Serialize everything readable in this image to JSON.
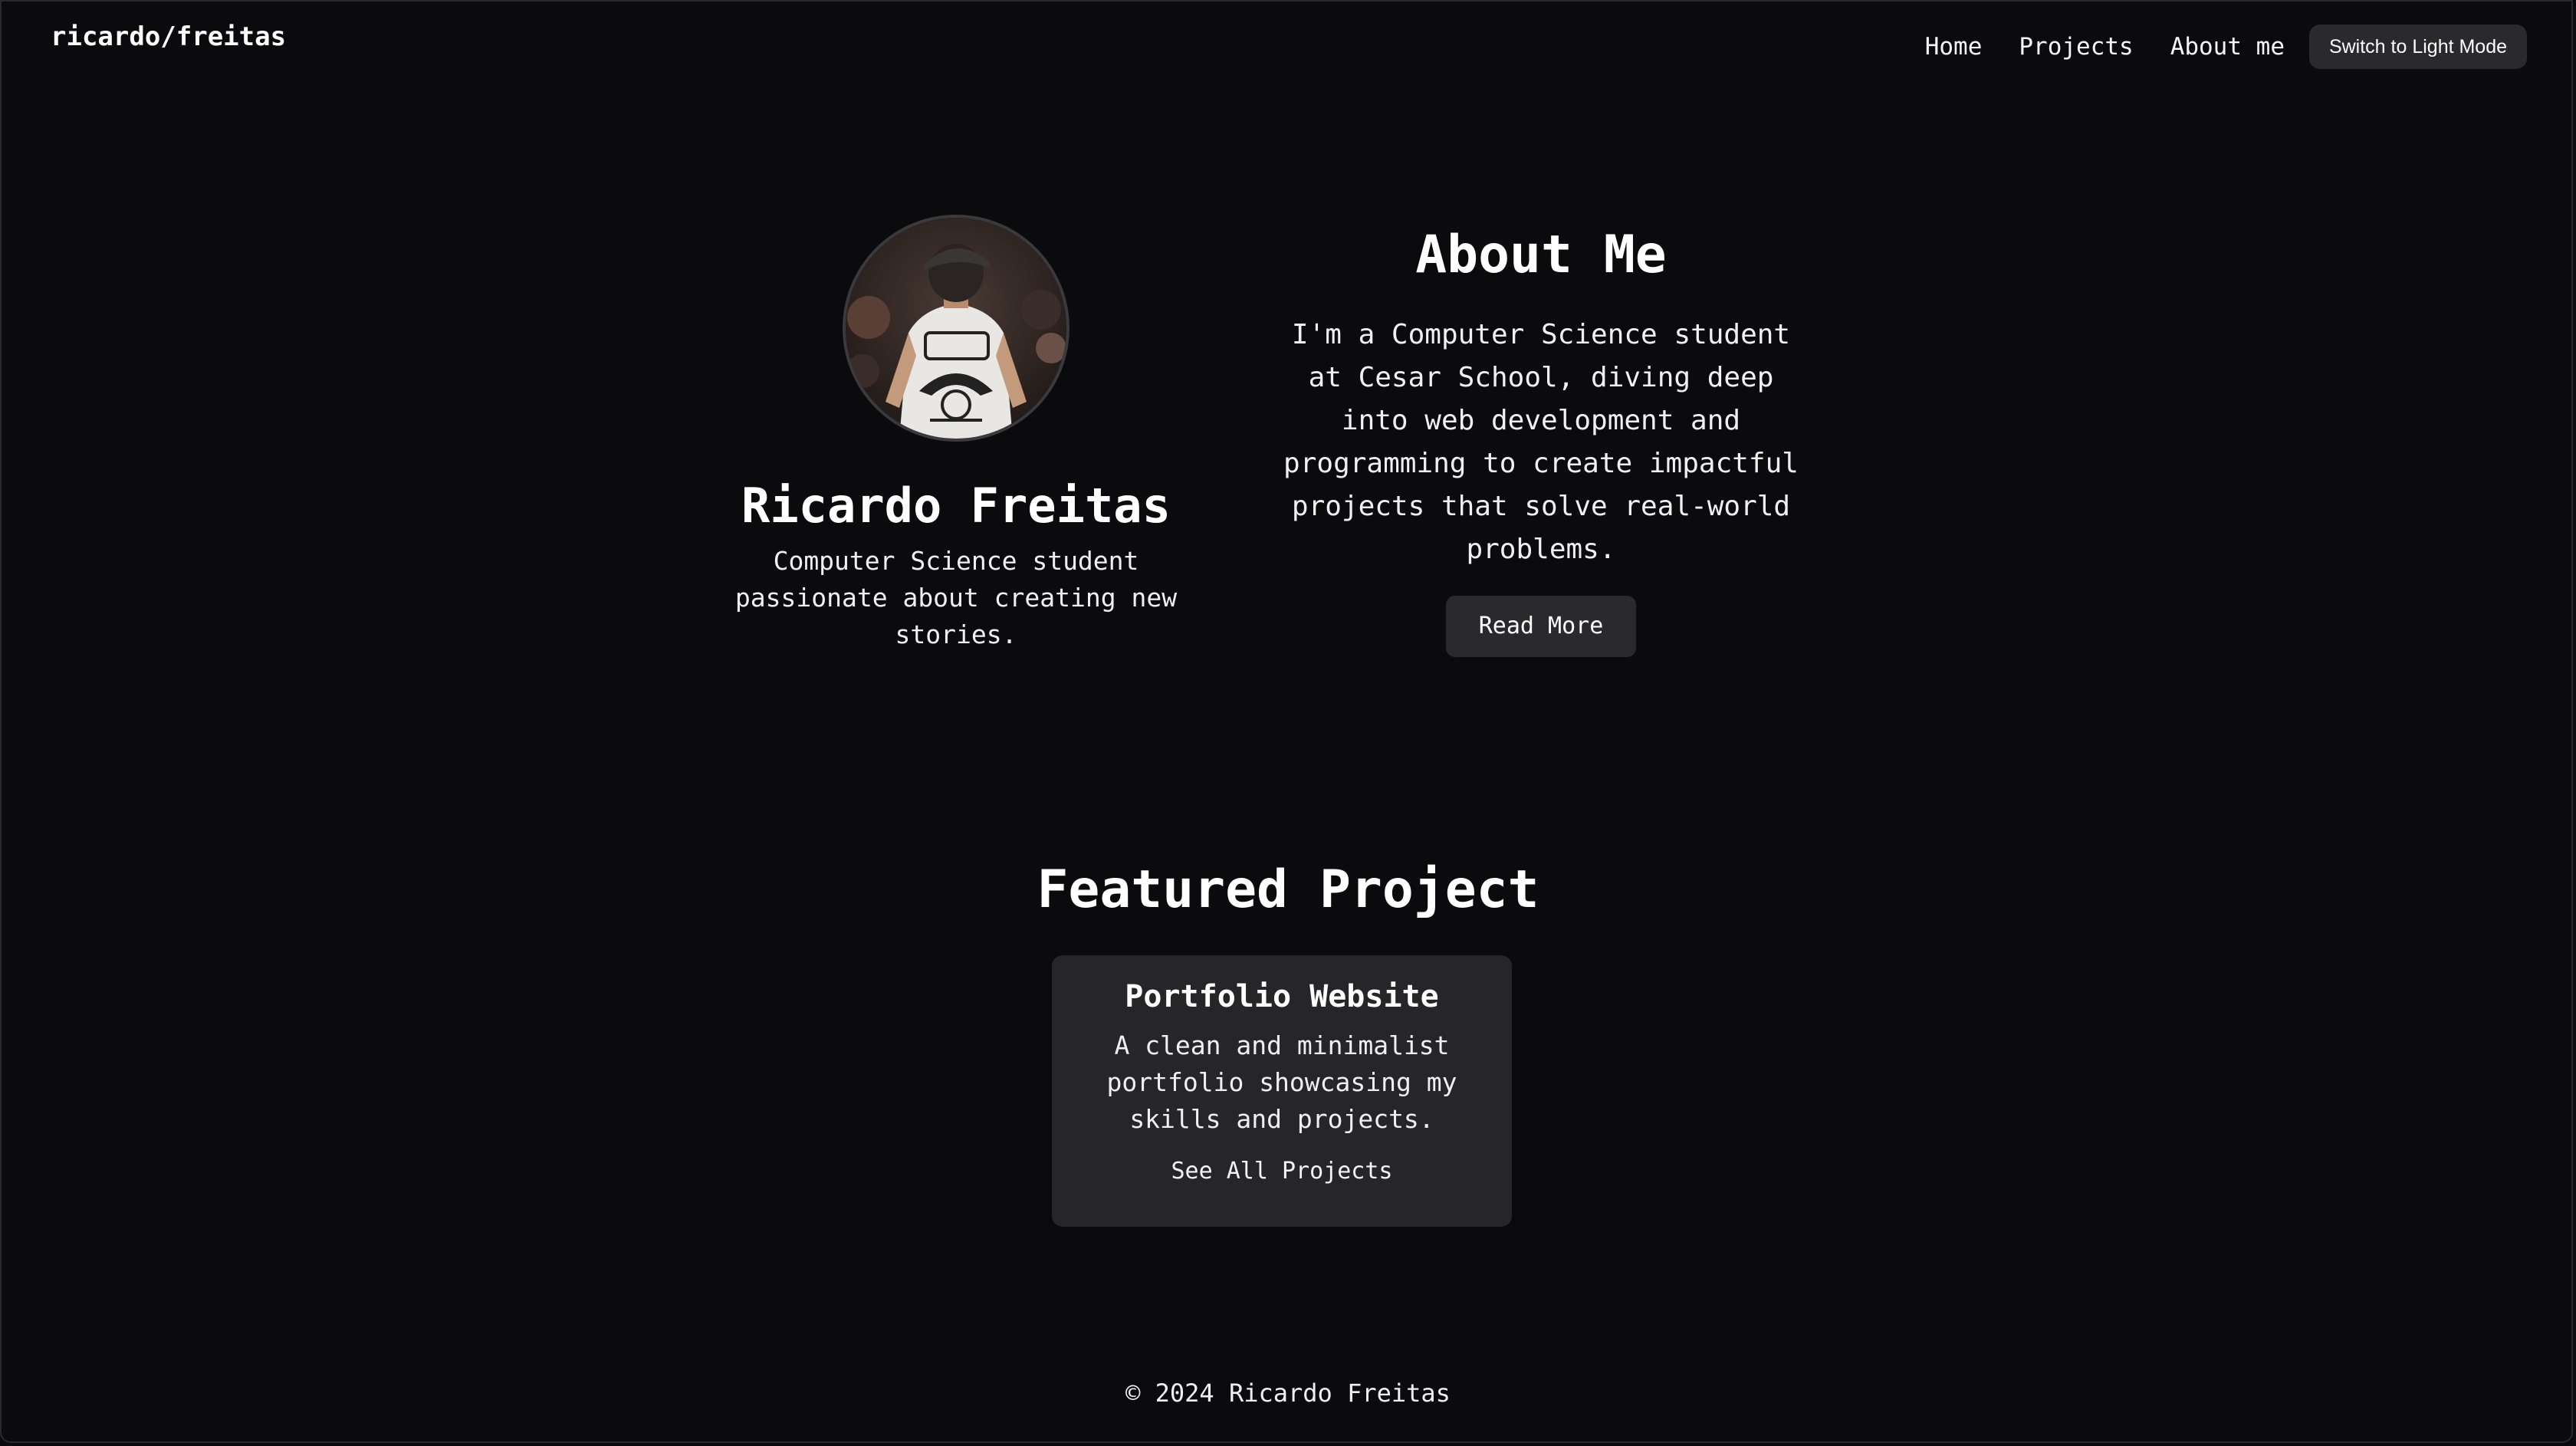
{
  "header": {
    "brand": "ricardo/freitas",
    "nav": [
      "Home",
      "Projects",
      "About me"
    ],
    "theme_button": "Switch to Light Mode"
  },
  "profile": {
    "name": "Ricardo Freitas",
    "tagline": "Computer Science student passionate about creating new stories."
  },
  "about": {
    "title": "About Me",
    "text": "I'm a Computer Science student at Cesar School, diving deep into web development and programming to create impactful projects that solve real-world problems.",
    "button": "Read More"
  },
  "featured": {
    "title": "Featured Project",
    "card": {
      "title": "Portfolio Website",
      "description": "A clean and minimalist portfolio showcasing my skills and projects.",
      "link": "See All Projects"
    }
  },
  "footer": {
    "text": "© 2024 Ricardo Freitas"
  },
  "colors": {
    "background": "#0b0b0d",
    "surface": "#262629",
    "button": "#2a2a2e",
    "text": "#ffffff"
  }
}
